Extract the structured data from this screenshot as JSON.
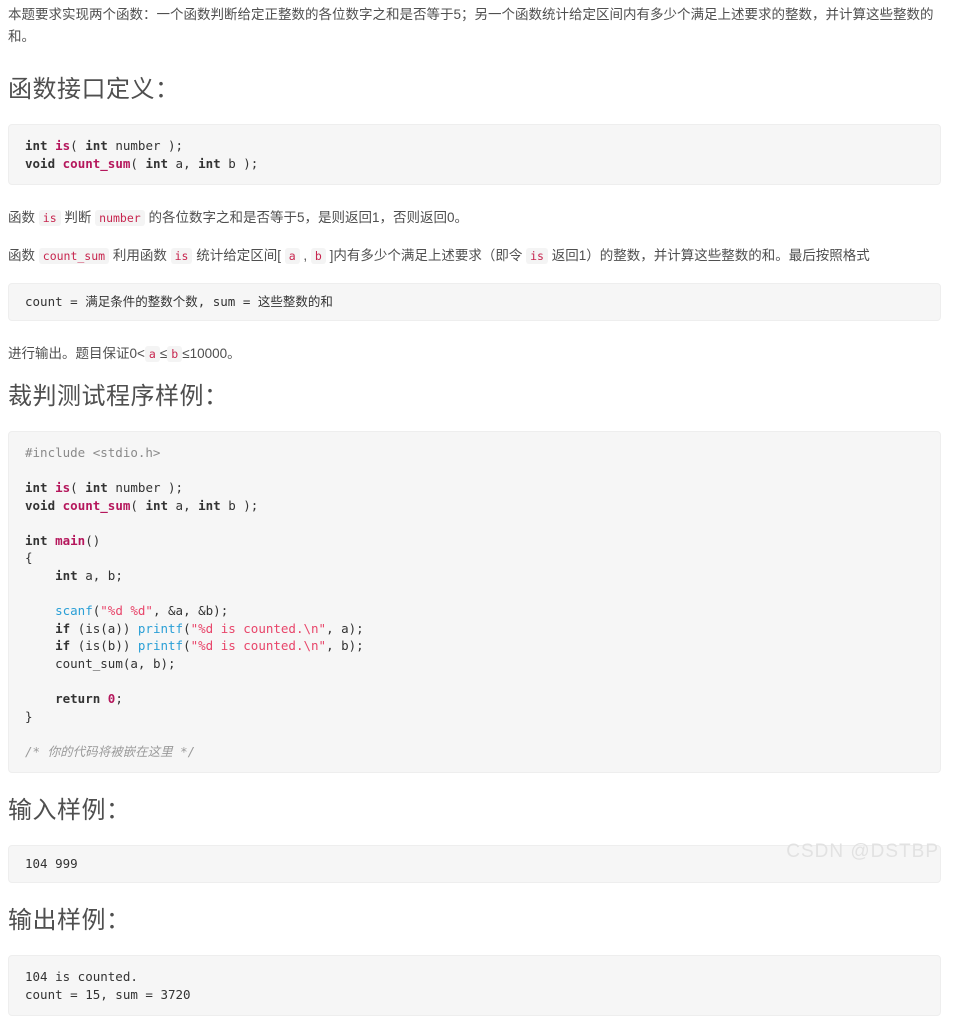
{
  "intro": {
    "paragraph": "本题要求实现两个函数：一个函数判断给定正整数的各位数字之和是否等于5；另一个函数统计给定区间内有多少个满足上述要求的整数，并计算这些整数的和。"
  },
  "sections": {
    "interface_title": "函数接口定义：",
    "judge_title": "裁判测试程序样例：",
    "input_title": "输入样例：",
    "output_title": "输出样例："
  },
  "interface_code": {
    "line1": {
      "kw1": "int",
      "fn1": "is",
      "rest1": "( ",
      "kw2": "int",
      "param1": " number );"
    },
    "line2": {
      "kw1": "void",
      "fn1": "count_sum",
      "rest1": "( ",
      "kw2": "int",
      "param1": " a, ",
      "kw3": "int",
      "param2": " b );"
    },
    "plain": "int is( int number );\nvoid count_sum( int a, int b );"
  },
  "desc": {
    "p1_a": "函数 ",
    "p1_code1": "is",
    "p1_b": " 判断 ",
    "p1_code2": "number",
    "p1_c": " 的各位数字之和是否等于5，是则返回1，否则返回0。",
    "p2_a": "函数 ",
    "p2_code1": "count_sum",
    "p2_b": " 利用函数 ",
    "p2_code2": "is",
    "p2_c": " 统计给定区间[ ",
    "p2_code3": "a",
    "p2_d": " , ",
    "p2_code4": "b",
    "p2_e": " ]内有多少个满足上述要求（即令 ",
    "p2_code5": "is",
    "p2_f": " 返回1）的整数，并计算这些整数的和。最后按照格式",
    "format_code": "count = 满足条件的整数个数, sum = 这些整数的和",
    "p3_a": "进行输出。题目保证0",
    "p3_lt1": "<",
    "p3_code1": "a",
    "p3_le1": "≤",
    "p3_code2": "b",
    "p3_le2": "≤",
    "p3_b": "10000。"
  },
  "judge_code": {
    "include": "#include <stdio.h>",
    "lines": [
      "#include <stdio.h>",
      "",
      "int is( int number );",
      "void count_sum( int a, int b );",
      "",
      "int main()",
      "{",
      "    int a, b;",
      "",
      "    scanf(\"%d %d\", &a, &b);",
      "    if (is(a)) printf(\"%d is counted.\\n\", a);",
      "    if (is(b)) printf(\"%d is counted.\\n\", b);",
      "    count_sum(a, b);",
      "",
      "    return 0;",
      "}",
      "",
      "/* 你的代码将被嵌在这里 */"
    ],
    "tokens": {
      "kw_int": "int",
      "kw_void": "void",
      "kw_if": "if",
      "kw_return": "return",
      "fn_is": "is",
      "fn_count_sum": "count_sum",
      "fn_main": "main",
      "call_scanf": "scanf",
      "call_printf": "printf",
      "str_scanf": "\"%d %d\"",
      "str_printf": "\"%d is counted.\\n\"",
      "num_zero": "0",
      "comment": "/* 你的代码将被嵌在这里 */"
    }
  },
  "input_sample": {
    "text": "104 999"
  },
  "output_sample": {
    "line1": "104 is counted.",
    "line2": "count = 15, sum = 3720"
  },
  "watermark": {
    "text": "CSDN @DSTBP"
  },
  "colors": {
    "body_text": "#4f4f4f",
    "code_bg": "#f6f6f6",
    "code_border": "#eeeeee",
    "inline_code_text": "#c7254e",
    "keyword": "#333333",
    "function_name": "#b5175c",
    "library_call": "#2a9fd6",
    "string": "#e8456a",
    "comment": "#9a9a9a",
    "preprocessor": "#8a8a8a",
    "watermark": "#e2e2e2"
  }
}
